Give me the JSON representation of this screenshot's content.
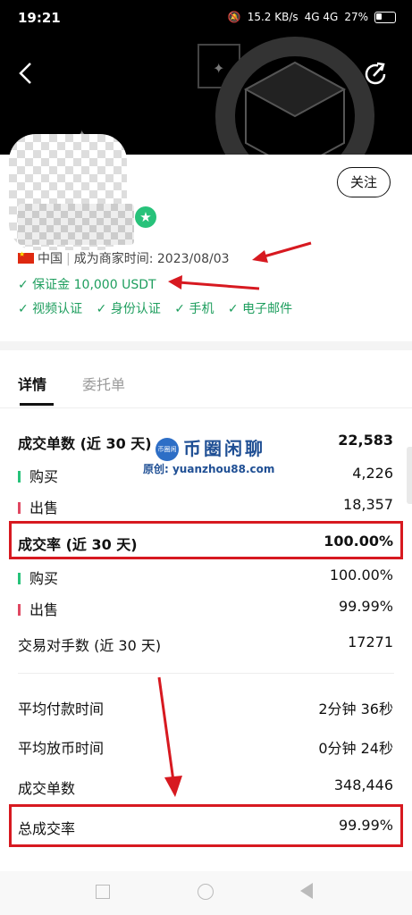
{
  "status_bar": {
    "time": "19:21",
    "speed": "15.2 KB/s",
    "network": "4G 4G",
    "battery": "27%"
  },
  "profile": {
    "follow_label": "关注",
    "country": "中国",
    "merchant_since_label": "成为商家时间:",
    "merchant_since_date": "2023/08/03",
    "deposit": "✓ 保证金 10,000 USDT",
    "verifications": [
      "✓ 视频认证",
      "✓ 身份认证",
      "✓ 手机",
      "✓ 电子邮件"
    ]
  },
  "tabs": [
    {
      "label": "详情",
      "active": true
    },
    {
      "label": "委托单",
      "active": false
    }
  ],
  "watermark": {
    "logo_text": "币圈闲聊",
    "title": "币圈闲聊",
    "subtitle": "原创: yuanzhou88.com"
  },
  "stats": {
    "orders_30d_label": "成交单数 (近 30 天)",
    "orders_30d_value": "22,583",
    "buy_label": "购买",
    "buy_value": "4,226",
    "sell_label": "出售",
    "sell_value": "18,357",
    "completion_30d_label": "成交率 (近 30 天)",
    "completion_30d_value": "100.00%",
    "buy_rate_label": "购买",
    "buy_rate_value": "100.00%",
    "sell_rate_label": "出售",
    "sell_rate_value": "99.99%",
    "counterparties_label": "交易对手数 (近 30 天)",
    "counterparties_value": "17271",
    "avg_pay_label": "平均付款时间",
    "avg_pay_value": "2分钟 36秒",
    "avg_release_label": "平均放币时间",
    "avg_release_value": "0分钟 24秒",
    "total_orders_label": "成交单数",
    "total_orders_value": "348,446",
    "total_completion_label": "总成交率",
    "total_completion_value": "99.99%"
  },
  "colors": {
    "buy": "#27c27a",
    "sell": "#e04862",
    "highlight": "#d71920",
    "verified": "#1e9e5e"
  }
}
